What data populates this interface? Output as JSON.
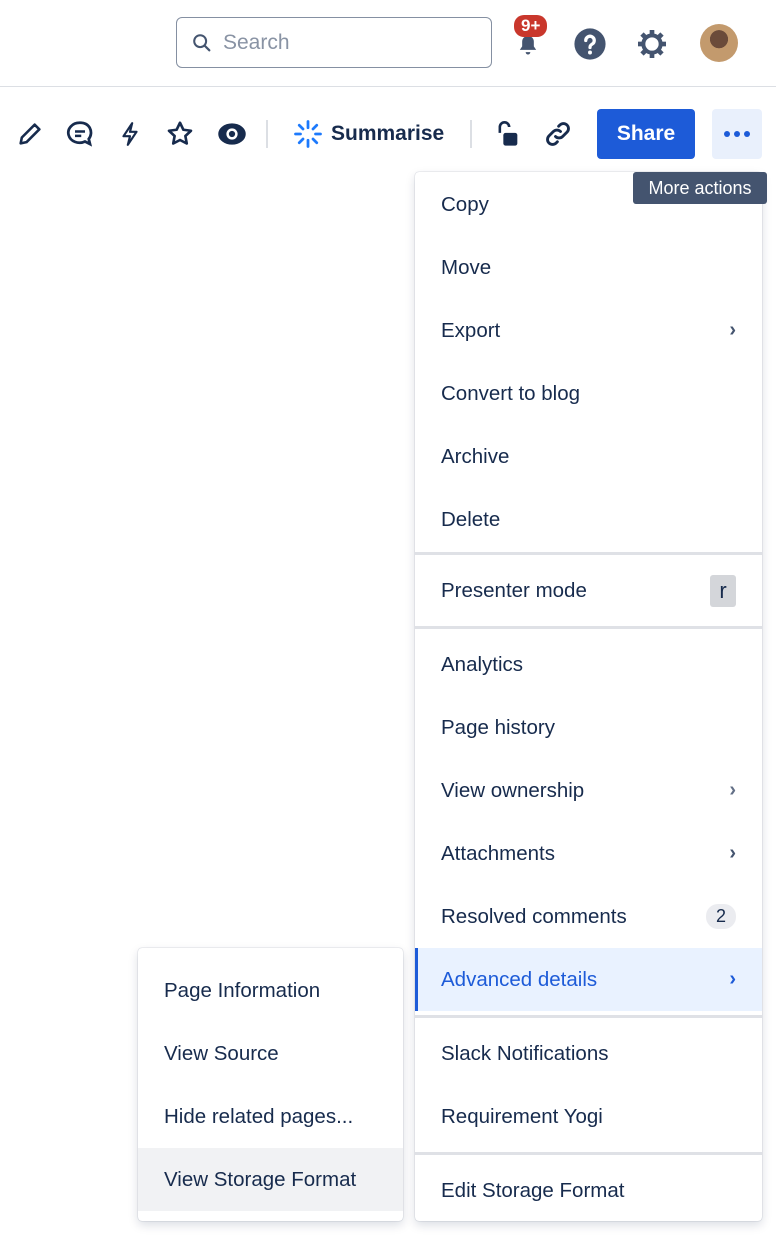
{
  "header": {
    "search_placeholder": "Search",
    "notification_badge": "9+",
    "icons": [
      "search-icon",
      "notification-icon",
      "help-icon",
      "settings-icon",
      "avatar"
    ]
  },
  "toolbar": {
    "summarise_label": "Summarise",
    "share_label": "Share",
    "more_tooltip": "More actions",
    "accent": "#1d5bd8"
  },
  "menu": {
    "groups": [
      [
        {
          "label": "Copy"
        },
        {
          "label": "Move"
        },
        {
          "label": "Export",
          "submenu": true
        },
        {
          "label": "Convert to blog"
        },
        {
          "label": "Archive"
        },
        {
          "label": "Delete"
        }
      ],
      [
        {
          "label": "Presenter mode",
          "shortcut": "r"
        }
      ],
      [
        {
          "label": "Analytics"
        },
        {
          "label": "Page history"
        },
        {
          "label": "View ownership",
          "submenu": true
        },
        {
          "label": "Attachments",
          "submenu": true
        },
        {
          "label": "Resolved comments",
          "count": "2"
        },
        {
          "label": "Advanced details",
          "submenu": true,
          "active": true
        }
      ],
      [
        {
          "label": "Slack Notifications"
        },
        {
          "label": "Requirement Yogi"
        }
      ],
      [
        {
          "label": "Edit Storage Format"
        }
      ]
    ]
  },
  "submenu": {
    "items": [
      {
        "label": "Page Information"
      },
      {
        "label": "View Source"
      },
      {
        "label": "Hide related pages..."
      },
      {
        "label": "View Storage Format",
        "hover": true
      }
    ]
  }
}
